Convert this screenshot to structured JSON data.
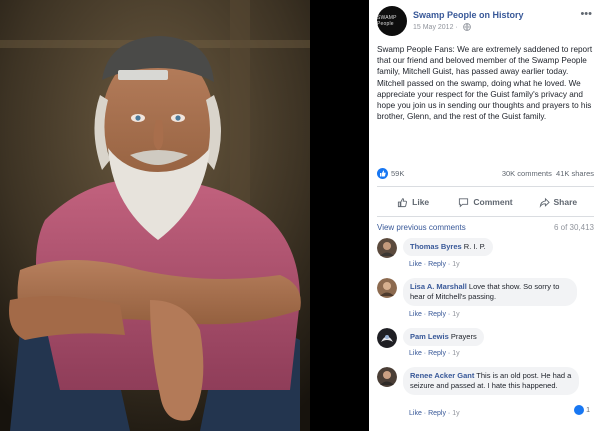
{
  "post": {
    "page_name": "Swamp People on History",
    "avatar_text": "SWAMP People",
    "date": "15 May 2012 · ",
    "body": "Swamp People Fans: We are extremely saddened to report that our friend and beloved member of the Swamp People family, Mitchell Guist, has passed away earlier today. Mitchell passed on the swamp, doing what he loved. We appreciate your respect for the Guist family's privacy and hope you join us in sending our thoughts and prayers to his brother, Glenn, and the rest of the Guist family.",
    "likes": "59K",
    "comments_count": "30K comments",
    "shares_count": "41K shares"
  },
  "actions": {
    "like": "Like",
    "comment": "Comment",
    "share": "Share"
  },
  "comments_bar": {
    "view_previous": "View previous comments",
    "count": "6 of 30,413"
  },
  "comments": [
    {
      "author": "Thomas Byres",
      "text": "R. I. P.",
      "like": "Like",
      "reply": "Reply",
      "time": "1y"
    },
    {
      "author": "Lisa A. Marshall",
      "text": "Love that show. So sorry to hear of Mitchell's passing.",
      "like": "Like",
      "reply": "Reply",
      "time": "1y"
    },
    {
      "author": "Pam Lewis",
      "text": "Prayers",
      "like": "Like",
      "reply": "Reply",
      "time": "1y"
    },
    {
      "author": "Renee Acker Gant",
      "text": "This is an old post. He had a seizure and passed at. I hate this happened.",
      "like": "Like",
      "reply": "Reply",
      "time": "1y",
      "reactions": "1"
    }
  ],
  "colors": {
    "link": "#385898",
    "brand_blue": "#1877f2",
    "muted": "#90949c"
  },
  "icons": [
    "globe-icon",
    "more-icon",
    "like-icon",
    "comment-icon",
    "share-icon"
  ]
}
